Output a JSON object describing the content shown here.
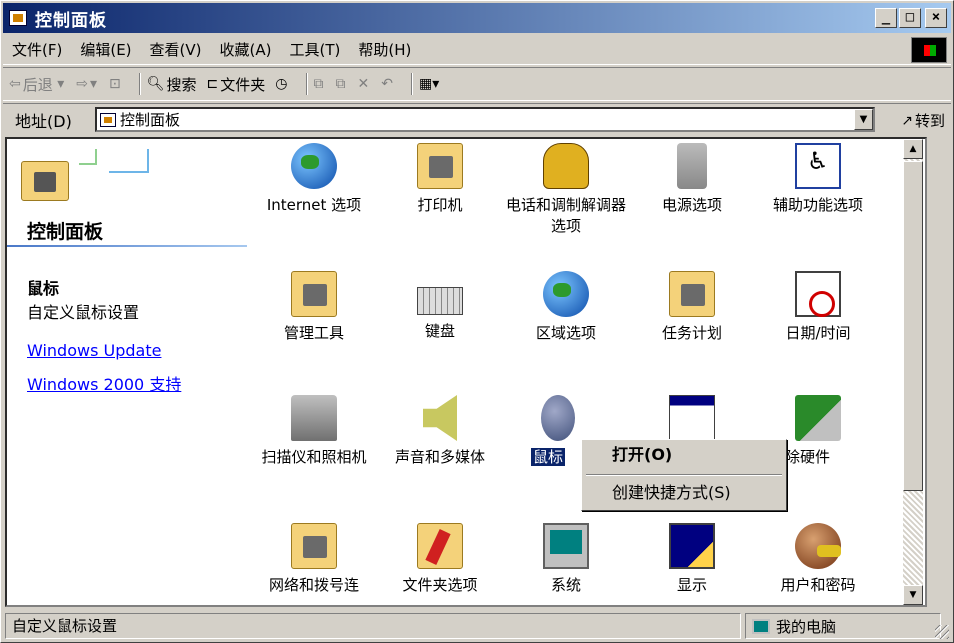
{
  "window": {
    "title": "控制面板",
    "minimize": "_",
    "maximize": "□",
    "close": "×"
  },
  "menu": [
    "文件(F)",
    "编辑(E)",
    "查看(V)",
    "收藏(A)",
    "工具(T)",
    "帮助(H)"
  ],
  "toolbar": {
    "back": "后退",
    "search": "搜索",
    "folders": "文件夹"
  },
  "address": {
    "label": "地址(D)",
    "value": "控制面板",
    "goto": "转到"
  },
  "left_pane": {
    "title": "控制面板",
    "item_name": "鼠标",
    "item_desc": "自定义鼠标设置",
    "links": [
      "Windows Update",
      "Windows 2000 支持"
    ]
  },
  "icons": [
    {
      "label": "Internet 选项",
      "icon": "globe-icon"
    },
    {
      "label": "打印机",
      "icon": "printer-folder-icon"
    },
    {
      "label": "电话和调制解调器选项",
      "icon": "phone-icon"
    },
    {
      "label": "电源选项",
      "icon": "power-icon"
    },
    {
      "label": "辅助功能选项",
      "icon": "accessibility-icon"
    },
    {
      "label": "管理工具",
      "icon": "admin-tools-icon"
    },
    {
      "label": "键盘",
      "icon": "keyboard-icon"
    },
    {
      "label": "区域选项",
      "icon": "globe-icon"
    },
    {
      "label": "任务计划",
      "icon": "scheduled-tasks-icon"
    },
    {
      "label": "日期/时间",
      "icon": "calendar-clock-icon"
    },
    {
      "label": "扫描仪和照相机",
      "icon": "scanner-icon"
    },
    {
      "label": "声音和多媒体",
      "icon": "speaker-icon"
    },
    {
      "label": "鼠标",
      "icon": "mouse-icon"
    },
    {
      "label": "",
      "icon": "app-window-icon"
    },
    {
      "label": "/删除硬件",
      "icon": "hardware-icon"
    },
    {
      "label": "网络和拨号连",
      "icon": "network-folder-icon"
    },
    {
      "label": "文件夹选项",
      "icon": "folder-options-icon"
    },
    {
      "label": "系统",
      "icon": "computer-icon"
    },
    {
      "label": "显示",
      "icon": "display-icon"
    },
    {
      "label": "用户和密码",
      "icon": "users-icon"
    }
  ],
  "context_menu": {
    "open": "打开(O)",
    "shortcut": "创建快捷方式(S)"
  },
  "status": {
    "left": "自定义鼠标设置",
    "right": "我的电脑"
  }
}
